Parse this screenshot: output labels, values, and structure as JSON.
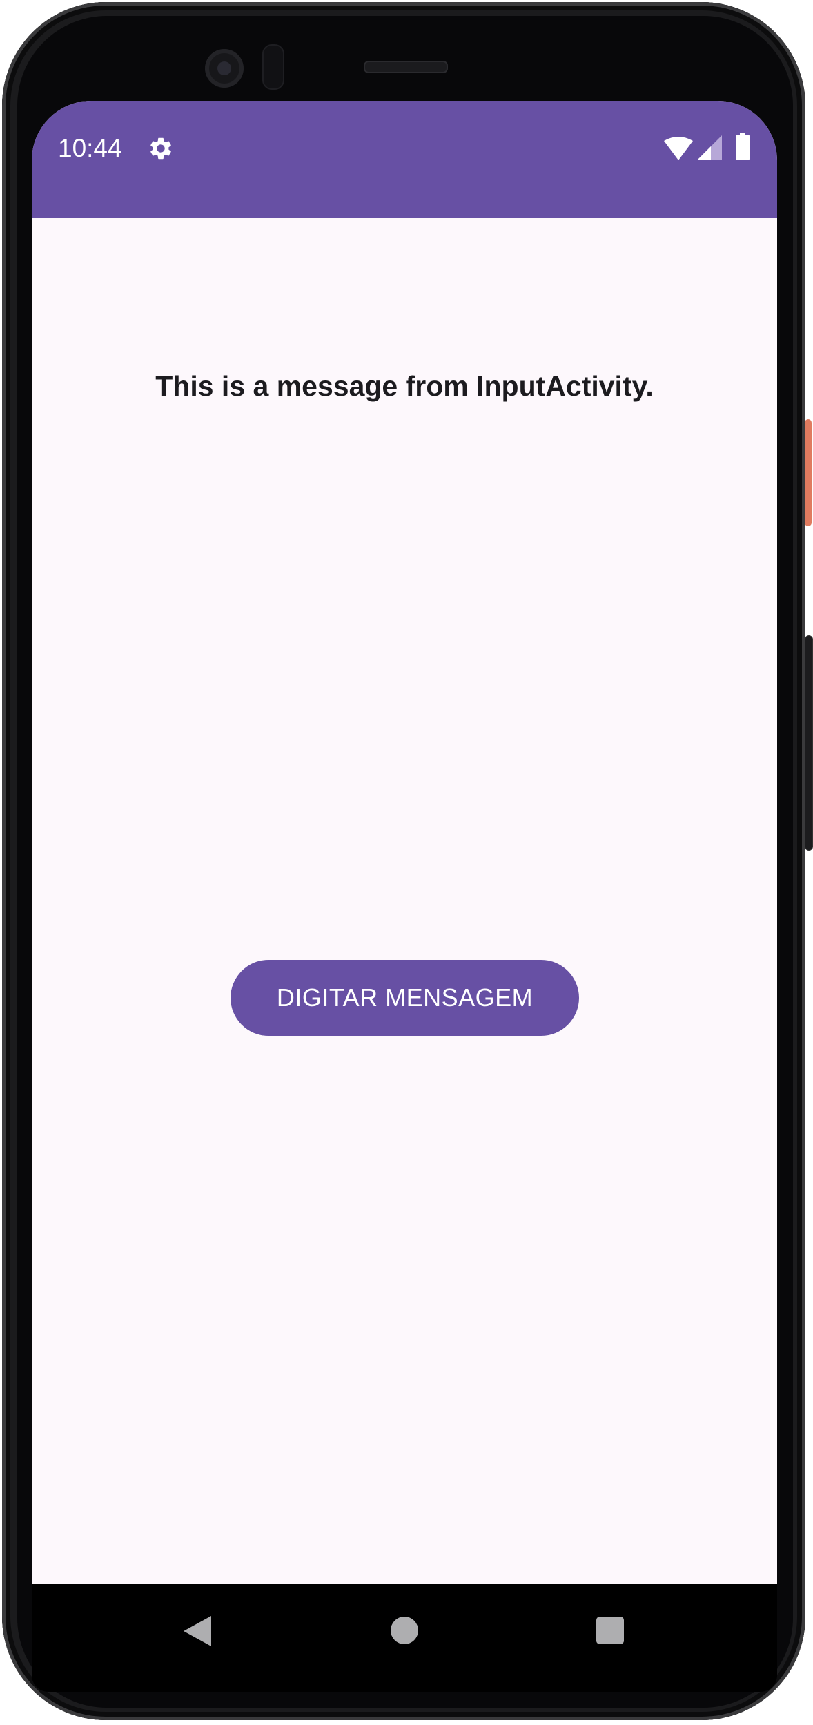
{
  "status_bar": {
    "time": "10:44",
    "settings_icon": "gear-icon",
    "wifi_icon": "wifi-icon",
    "signal_icon": "cell-signal-icon",
    "battery_icon": "battery-icon",
    "background_color": "#6750a4"
  },
  "main": {
    "message": "This is a message from InputActivity.",
    "button_label": "DIGITAR MENSAGEM",
    "accent_color": "#6750a4",
    "background_color": "#fdf8fc"
  },
  "nav_bar": {
    "back_icon": "back-triangle-icon",
    "home_icon": "home-circle-icon",
    "recents_icon": "recents-square-icon"
  }
}
